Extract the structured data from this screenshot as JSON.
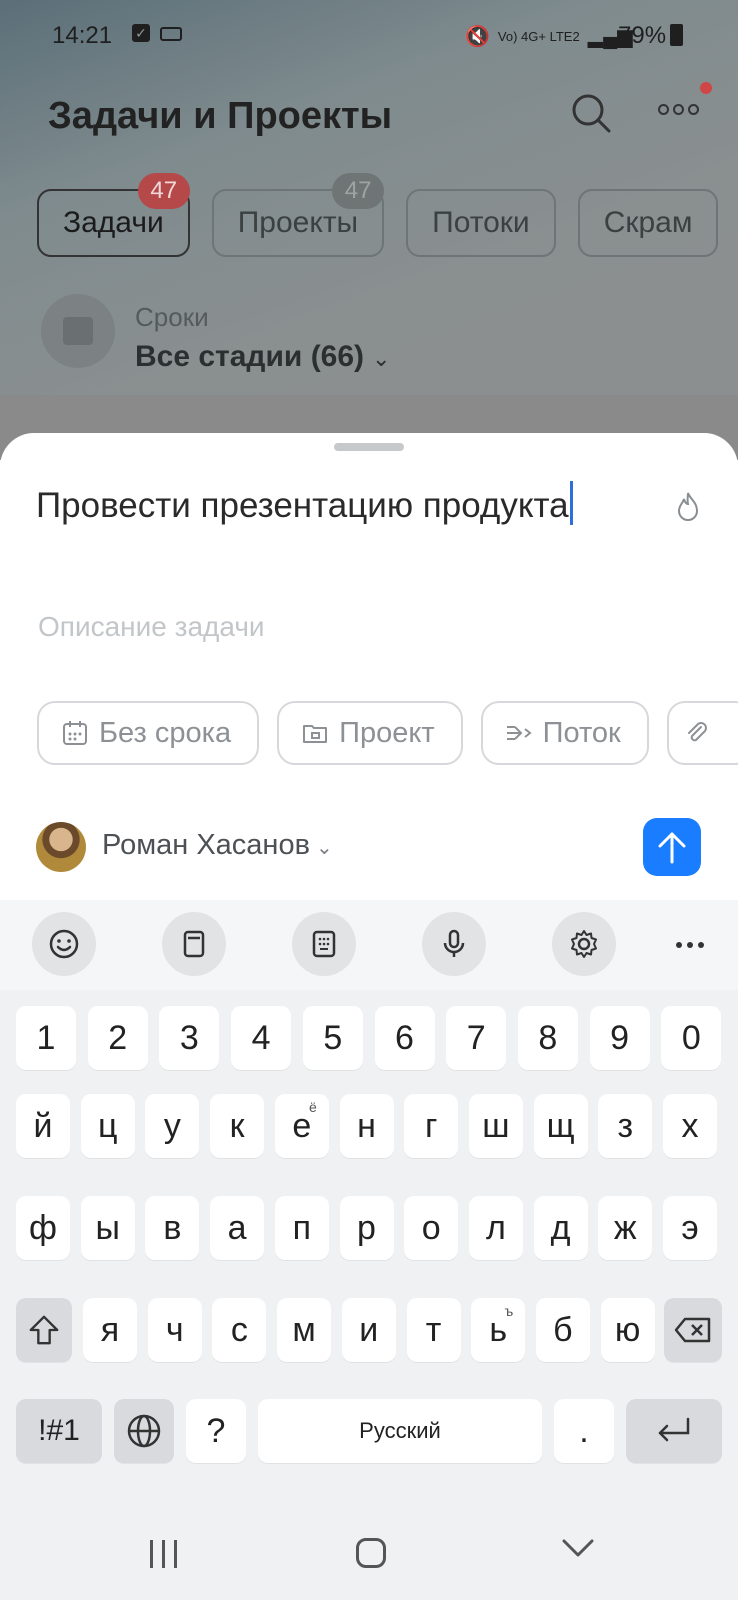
{
  "status_bar": {
    "time": "14:21",
    "network_label": "Vo) 4G+ LTE2",
    "battery": "79%"
  },
  "background_app": {
    "title": "Задачи и Проекты",
    "tabs": [
      {
        "label": "Задачи",
        "badge": "47"
      },
      {
        "label": "Проекты",
        "badge": "47"
      },
      {
        "label": "Потоки"
      },
      {
        "label": "Скрам"
      }
    ],
    "stage_caption": "Сроки",
    "stage_value": "Все стадии (66)"
  },
  "sheet": {
    "task_title": "Провести презентацию продукта",
    "description_placeholder": "Описание задачи",
    "chips": [
      {
        "label": "Без срока",
        "icon": "calendar-icon"
      },
      {
        "label": "Проект",
        "icon": "folder-icon"
      },
      {
        "label": "Поток",
        "icon": "flow-icon"
      }
    ],
    "owner_name": "Роман Хасанов"
  },
  "keyboard": {
    "toolbar": [
      "emoji-icon",
      "clipboard-icon",
      "keypad-icon",
      "mic-icon",
      "settings-icon",
      "more-icon"
    ],
    "row_numbers": [
      "1",
      "2",
      "3",
      "4",
      "5",
      "6",
      "7",
      "8",
      "9",
      "0"
    ],
    "row1": [
      "й",
      "ц",
      "у",
      "к",
      "е",
      "н",
      "г",
      "ш",
      "щ",
      "з",
      "х"
    ],
    "row1_alt_e": "ё",
    "row2": [
      "ф",
      "ы",
      "в",
      "а",
      "п",
      "р",
      "о",
      "л",
      "д",
      "ж",
      "э"
    ],
    "row3": [
      "я",
      "ч",
      "с",
      "м",
      "и",
      "т",
      "ь",
      "б",
      "ю"
    ],
    "row3_alt_soft": "ъ",
    "symbols_label": "!#1",
    "question": "?",
    "space_label": "Русский",
    "period": "."
  },
  "colors": {
    "accent": "#1a7cff",
    "badge_red": "#b54848",
    "caret": "#2f6fd8"
  }
}
